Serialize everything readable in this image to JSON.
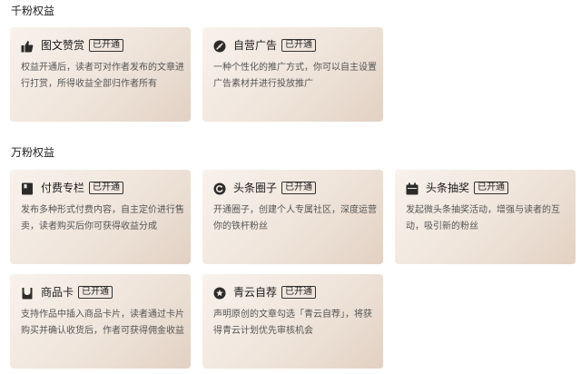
{
  "sections": {
    "thousand": {
      "title": "千粉权益"
    },
    "tenthousand": {
      "title": "万粉权益"
    }
  },
  "status_label": "已开通",
  "cards": [
    {
      "icon": "thumbs-up-icon",
      "title": "图文赞赏",
      "desc": "权益开通后，读者可对作者发布的文章进行打赏，所得收益全部归作者所有"
    },
    {
      "icon": "gauge-icon",
      "title": "自营广告",
      "desc": "一种个性化的推广方式，你可以自主设置广告素材并进行投放推广"
    },
    {
      "icon": "bookmark-book-icon",
      "title": "付费专栏",
      "desc": "发布多种形式付费内容，自主定价进行售卖，读者购买后你可获得收益分成"
    },
    {
      "icon": "refresh-circle-icon",
      "title": "头条圈子",
      "desc": "开通圈子，创建个人专属社区，深度运营你的铁杆粉丝"
    },
    {
      "icon": "calendar-icon",
      "title": "头条抽奖",
      "desc": "发起微头条抽奖活动，增强与读者的互动，吸引新的粉丝"
    },
    {
      "icon": "shopping-bag-icon",
      "title": "商品卡",
      "desc": "支持作品中插入商品卡片，读者通过卡片购买并确认收货后，作者可获得佣金收益"
    },
    {
      "icon": "star-circle-icon",
      "title": "青云自荐",
      "desc": "声明原创的文章勾选「青云自荐」，将获得青云计划优先审核机会"
    }
  ],
  "colors": {
    "card_gradient_start": "#f8f2ec",
    "card_gradient_end": "#e2d1c3",
    "text": "#222222",
    "desc": "#555555"
  }
}
